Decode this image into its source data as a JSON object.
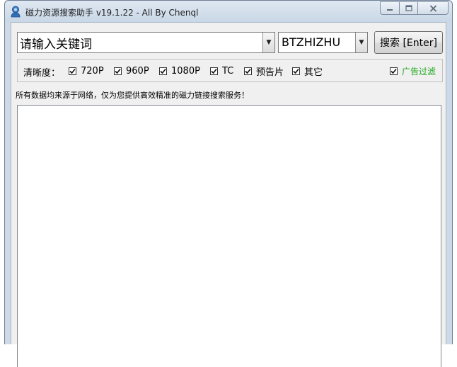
{
  "window": {
    "title": "磁力资源搜索助手 v19.1.22 - All By Chenql",
    "icon": "magnet-search-app-icon"
  },
  "caption": {
    "minimize_icon": "minimize-icon",
    "maximize_icon": "maximize-icon",
    "close_icon": "close-icon"
  },
  "search": {
    "keyword_value": "请输入关键词",
    "site_value": "BTZHIZHU",
    "search_button_label": "搜索 [Enter]"
  },
  "filters": {
    "label": "清晰度：",
    "options": [
      {
        "label": "720P",
        "checked": true
      },
      {
        "label": "960P",
        "checked": true
      },
      {
        "label": "1080P",
        "checked": true
      },
      {
        "label": "TC",
        "checked": true
      },
      {
        "label": "预告片",
        "checked": true
      },
      {
        "label": "其它",
        "checked": true
      }
    ],
    "ad_filter": {
      "label": "广告过滤",
      "checked": true
    }
  },
  "notice": "所有数据均来源于网络，仅为您提供高效精准的磁力链接搜索服务！",
  "colors": {
    "ad_filter_text": "#1fa81f",
    "titlebar": "#c9d7e6"
  }
}
